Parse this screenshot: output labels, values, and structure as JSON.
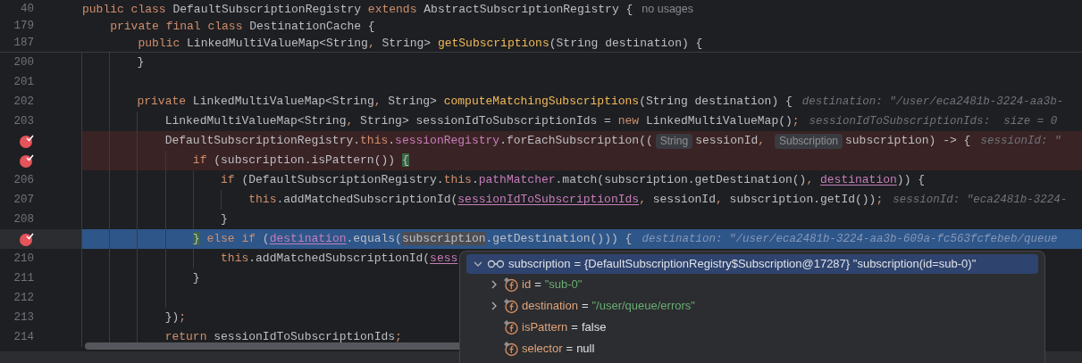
{
  "editor": {
    "sticky_lines": [
      {
        "number": "40",
        "tokens": [
          {
            "kind": "kw",
            "text": "public class "
          },
          {
            "kind": "text",
            "text": "DefaultSubscriptionRegistry "
          },
          {
            "kind": "kw",
            "text": "extends "
          },
          {
            "kind": "text",
            "text": "AbstractSubscriptionRegistry {"
          }
        ],
        "hint": {
          "kind": "usages",
          "text": "no usages"
        }
      },
      {
        "number": "179",
        "tokens": [
          {
            "kind": "kw",
            "text": "    private final class "
          },
          {
            "kind": "text",
            "text": "DestinationCache {"
          }
        ]
      },
      {
        "number": "187",
        "tokens": [
          {
            "kind": "kw",
            "text": "        public "
          },
          {
            "kind": "text",
            "text": "LinkedMultiValueMap<String"
          },
          {
            "kind": "punct",
            "text": ", "
          },
          {
            "kind": "text",
            "text": "String> "
          },
          {
            "kind": "method",
            "text": "getSubscriptions"
          },
          {
            "kind": "text",
            "text": "(String destination) {"
          }
        ]
      }
    ],
    "lines": [
      {
        "number": "200",
        "breakpoint": false,
        "suspended": false,
        "current": false,
        "tokens": [
          {
            "kind": "text",
            "text": "        }"
          }
        ]
      },
      {
        "number": "201",
        "breakpoint": false,
        "suspended": false,
        "current": false
      },
      {
        "number": "202",
        "breakpoint": false,
        "suspended": false,
        "current": false,
        "tokens": [
          {
            "kind": "kw",
            "text": "        private "
          },
          {
            "kind": "text",
            "text": "LinkedMultiValueMap<String"
          },
          {
            "kind": "punct",
            "text": ", "
          },
          {
            "kind": "text",
            "text": "String> "
          },
          {
            "kind": "method",
            "text": "computeMatchingSubscriptions"
          },
          {
            "kind": "text",
            "text": "(String destination) {"
          }
        ],
        "hint": {
          "kind": "value",
          "text": "destination: \"/user/eca2481b-3224-aa3b-"
        }
      },
      {
        "number": "203",
        "breakpoint": false,
        "suspended": false,
        "current": false,
        "tokens": [
          {
            "kind": "text",
            "text": "            LinkedMultiValueMap<String"
          },
          {
            "kind": "punct",
            "text": ", "
          },
          {
            "kind": "text",
            "text": "String> sessionIdToSubscriptionIds = "
          },
          {
            "kind": "kw",
            "text": "new "
          },
          {
            "kind": "text",
            "text": "LinkedMultiValueMap()"
          },
          {
            "kind": "punct",
            "text": ";"
          }
        ],
        "hint": {
          "kind": "value",
          "text": "sessionIdToSubscriptionIds:  size = 0"
        }
      },
      {
        "breakpoint": true,
        "suspended": true,
        "current": false,
        "tokens": [
          {
            "kind": "text",
            "text": "            DefaultSubscriptionRegistry."
          },
          {
            "kind": "kw",
            "text": "this"
          },
          {
            "kind": "text",
            "text": "."
          },
          {
            "kind": "field",
            "text": "sessionRegistry"
          },
          {
            "kind": "text",
            "text": ".forEachSubscription(("
          },
          {
            "kind": "chip",
            "text": "String"
          },
          {
            "kind": "text",
            "text": "sessionId"
          },
          {
            "kind": "punct",
            "text": ", "
          },
          {
            "kind": "chip",
            "text": "Subscription"
          },
          {
            "kind": "text",
            "text": "subscription) -> {"
          }
        ],
        "hint": {
          "kind": "value",
          "text": "sessionId: \""
        }
      },
      {
        "breakpoint": true,
        "suspended": true,
        "current": false,
        "tokens": [
          {
            "kind": "kw",
            "text": "                if "
          },
          {
            "kind": "text",
            "text": "(subscription.isPattern()) "
          },
          {
            "kind": "brace",
            "text": "{"
          }
        ]
      },
      {
        "number": "206",
        "breakpoint": false,
        "suspended": false,
        "current": false,
        "tokens": [
          {
            "kind": "kw",
            "text": "                    if "
          },
          {
            "kind": "text",
            "text": "(DefaultSubscriptionRegistry."
          },
          {
            "kind": "kw",
            "text": "this"
          },
          {
            "kind": "text",
            "text": "."
          },
          {
            "kind": "field",
            "text": "pathMatcher"
          },
          {
            "kind": "text",
            "text": ".match(subscription.getDestination()"
          },
          {
            "kind": "punct",
            "text": ", "
          },
          {
            "kind": "var",
            "text": "destination"
          },
          {
            "kind": "text",
            "text": ")) {"
          }
        ]
      },
      {
        "number": "207",
        "breakpoint": false,
        "suspended": false,
        "current": false,
        "tokens": [
          {
            "kind": "kw",
            "text": "                        this"
          },
          {
            "kind": "text",
            "text": ".addMatchedSubscriptionId("
          },
          {
            "kind": "var",
            "text": "sessionIdToSubscriptionIds"
          },
          {
            "kind": "punct",
            "text": ", "
          },
          {
            "kind": "text",
            "text": "sessionId"
          },
          {
            "kind": "punct",
            "text": ", "
          },
          {
            "kind": "text",
            "text": "subscription.getId())"
          },
          {
            "kind": "punct",
            "text": ";"
          }
        ],
        "hint": {
          "kind": "value",
          "text": "sessionId: \"eca2481b-3224-"
        }
      },
      {
        "number": "208",
        "breakpoint": false,
        "suspended": false,
        "current": false,
        "tokens": [
          {
            "kind": "text",
            "text": "                    }"
          }
        ]
      },
      {
        "breakpoint": true,
        "suspended": false,
        "current": true,
        "tokens": [
          {
            "kind": "brace",
            "text": "                }"
          },
          {
            "kind": "kw",
            "text": " else if "
          },
          {
            "kind": "text",
            "text": "("
          },
          {
            "kind": "var",
            "text": "destination"
          },
          {
            "kind": "text",
            "text": ".equals("
          },
          {
            "kind": "selected",
            "text": "subscription"
          },
          {
            "kind": "text",
            "text": ".getDestination())) {"
          }
        ],
        "hint": {
          "kind": "value",
          "text": "destination: \"/user/eca2481b-3224-aa3b-609a-fc563fcfebeb/queue"
        }
      },
      {
        "number": "210",
        "breakpoint": false,
        "suspended": false,
        "current": false,
        "tokens": [
          {
            "kind": "kw",
            "text": "                    this"
          },
          {
            "kind": "text",
            "text": ".addMatchedSubscriptionId("
          },
          {
            "kind": "var",
            "text": "sess"
          }
        ]
      },
      {
        "number": "211",
        "breakpoint": false,
        "suspended": false,
        "current": false,
        "tokens": [
          {
            "kind": "text",
            "text": "                }"
          }
        ]
      },
      {
        "number": "212",
        "breakpoint": false,
        "suspended": false,
        "current": false
      },
      {
        "number": "213",
        "breakpoint": false,
        "suspended": false,
        "current": false,
        "tokens": [
          {
            "kind": "text",
            "text": "            })"
          },
          {
            "kind": "punct",
            "text": ";"
          }
        ]
      },
      {
        "number": "214",
        "breakpoint": false,
        "suspended": false,
        "current": false,
        "tokens": [
          {
            "kind": "kw",
            "text": "            return "
          },
          {
            "kind": "text",
            "text": "sessionIdToSubscriptionIds"
          },
          {
            "kind": "punct",
            "text": ";"
          }
        ]
      }
    ]
  },
  "debug_popup": {
    "root": {
      "name": "subscription",
      "operator": "=",
      "value": "{DefaultSubscriptionRegistry$Subscription@17287} \"subscription(id=sub-0)\"",
      "expanded": true,
      "selected": true,
      "children": [
        {
          "name": "id",
          "operator": "=",
          "value": "\"sub-0\"",
          "kind": "string",
          "expandable": true,
          "expanded": false,
          "selected": false
        },
        {
          "name": "destination",
          "operator": "=",
          "value": "\"/user/queue/errors\"",
          "kind": "string",
          "expandable": true,
          "expanded": false,
          "selected": false
        },
        {
          "name": "isPattern",
          "operator": "=",
          "value": "false",
          "kind": "literal",
          "expandable": false,
          "selected": false
        },
        {
          "name": "selector",
          "operator": "=",
          "value": "null",
          "kind": "literal",
          "expandable": false,
          "selected": false
        }
      ]
    }
  }
}
